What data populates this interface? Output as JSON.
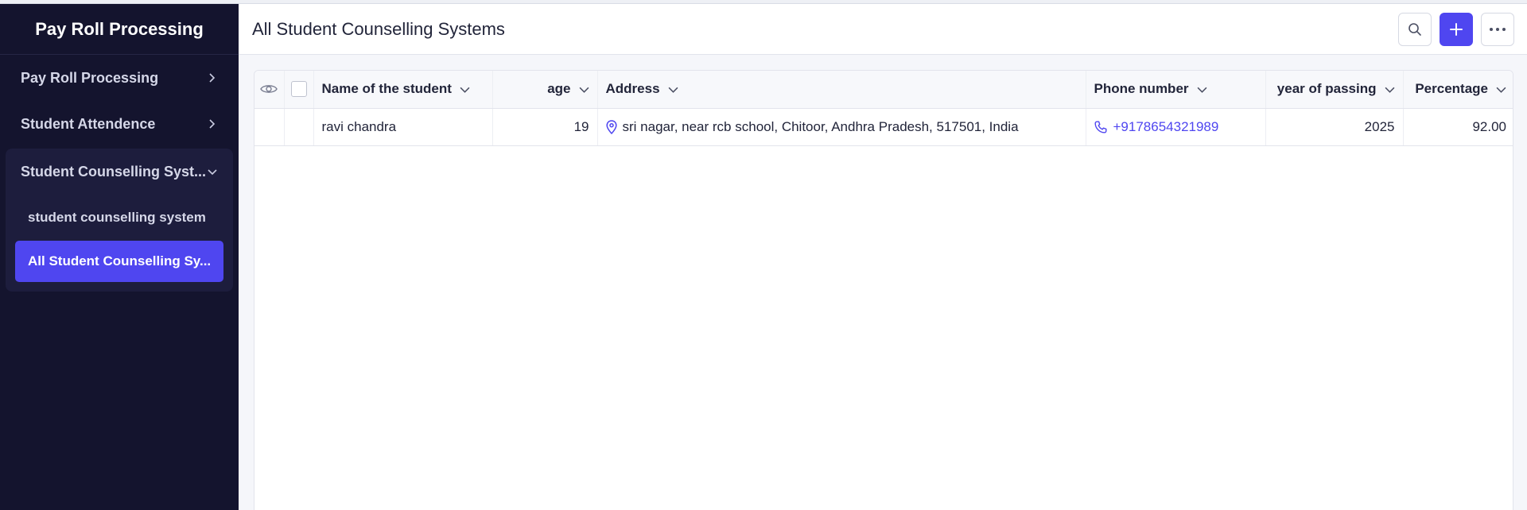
{
  "app": {
    "brand": "Pay Roll Processing"
  },
  "sidebar": {
    "items": [
      {
        "label": "Pay Roll Processing"
      },
      {
        "label": "Student Attendence"
      }
    ],
    "group": {
      "label": "Student Counselling Syst...",
      "children": [
        {
          "label": "student counselling system"
        },
        {
          "label": "All Student Counselling Sy..."
        }
      ]
    }
  },
  "header": {
    "title": "All Student Counselling Systems",
    "actions": [
      "search-icon",
      "plus-icon",
      "more-icon"
    ]
  },
  "table": {
    "columns": [
      {
        "label": "Name of the student"
      },
      {
        "label": "age"
      },
      {
        "label": "Address"
      },
      {
        "label": "Phone number"
      },
      {
        "label": "year of passing"
      },
      {
        "label": "Percentage"
      }
    ],
    "rows": [
      {
        "name": "ravi chandra",
        "age": "19",
        "address": "sri nagar, near rcb school, Chitoor, Andhra Pradesh, 517501, India",
        "phone": "+9178654321989",
        "year": "2025",
        "percentage": "92.00"
      }
    ]
  },
  "colors": {
    "sidebar_bg": "#14142e",
    "accent": "#4f46f0",
    "link": "#4f46f0"
  }
}
